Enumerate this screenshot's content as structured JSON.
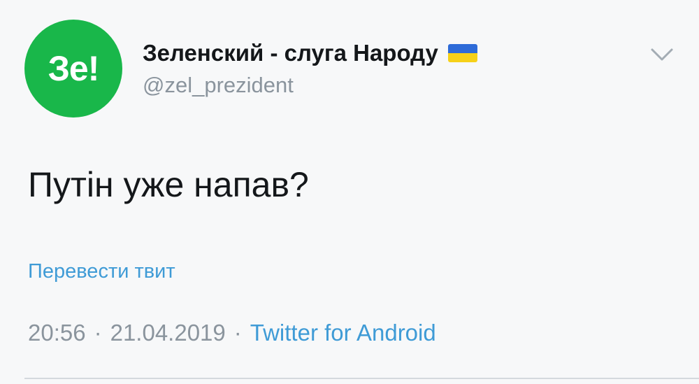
{
  "tweet": {
    "avatar": {
      "text": "Зе!",
      "background_color": "#19b74a"
    },
    "author": {
      "display_name": "Зеленский - слуга Народу",
      "flag_emoji": "ukraine-flag",
      "handle": "@zel_prezident"
    },
    "menu_icon": "chevron-down-icon",
    "text": "Путін уже напав?",
    "translate_label": "Перевести твит",
    "meta": {
      "time": "20:56",
      "separator": "·",
      "date": "21.04.2019",
      "source": "Twitter for Android"
    },
    "colors": {
      "link": "#3f9bd6",
      "muted": "#8a949d",
      "text": "#14171a",
      "flag_blue": "#2e6bd8",
      "flag_yellow": "#f6d119"
    }
  }
}
